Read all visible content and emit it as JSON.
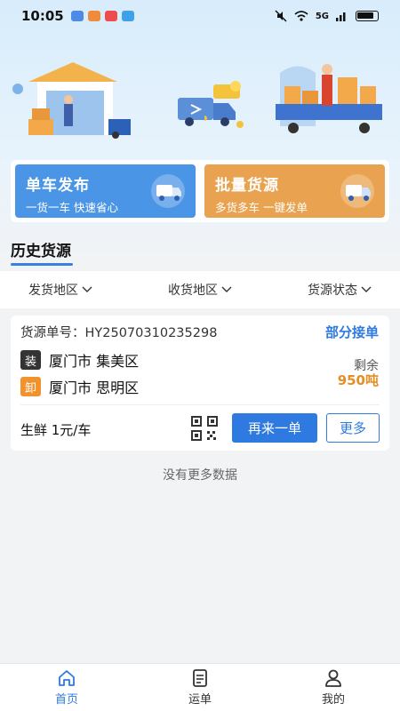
{
  "status_bar": {
    "time": "10:05",
    "network": "5G"
  },
  "banners": [
    {
      "title": "单车发布",
      "subtitle": "一货一车 快速省心",
      "color": "#4b95e6"
    },
    {
      "title": "批量货源",
      "subtitle": "多货多车 一键发单",
      "color": "#e9a350"
    }
  ],
  "section": {
    "title": "历史货源"
  },
  "filters": [
    {
      "label": "发货地区"
    },
    {
      "label": "收货地区"
    },
    {
      "label": "货源状态"
    }
  ],
  "order": {
    "number_label": "货源单号：",
    "number": "HY25070310235298",
    "status": "部分接单",
    "load_tag": "装",
    "load_city": "厦门市 集美区",
    "unload_tag": "卸",
    "unload_city": "厦门市 思明区",
    "remaining_label": "剩余",
    "remaining_value": "950吨",
    "cargo": "生鲜 1元/车",
    "reorder_button": "再来一单",
    "more_button": "更多"
  },
  "no_more": "没有更多数据",
  "tabs": [
    {
      "label": "首页",
      "icon": "home-icon",
      "active": true
    },
    {
      "label": "运单",
      "icon": "document-icon",
      "active": false
    },
    {
      "label": "我的",
      "icon": "user-icon",
      "active": false
    }
  ],
  "colors": {
    "primary": "#2f7ae0",
    "accent": "#e48e26",
    "unload_tag": "#f2922d"
  }
}
